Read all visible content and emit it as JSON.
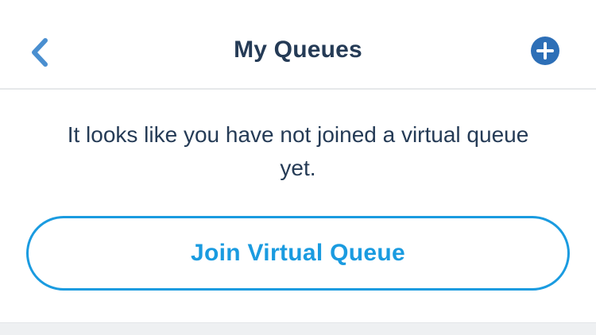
{
  "nav": {
    "title": "My Queues",
    "back_icon": "chevron-left-icon",
    "add_icon": "plus-circle-icon"
  },
  "main": {
    "message": "It looks like you have not joined a virtual queue yet.",
    "join_button_label": "Join Virtual Queue"
  },
  "colors": {
    "accent": "#1a9be0",
    "back_chevron": "#4a8fd0",
    "add_icon_fill": "#2d6fb7",
    "title_text": "#253b56",
    "body_text": "#253b56",
    "divider": "#e6e8ea",
    "footer_band": "#eef0f2"
  }
}
